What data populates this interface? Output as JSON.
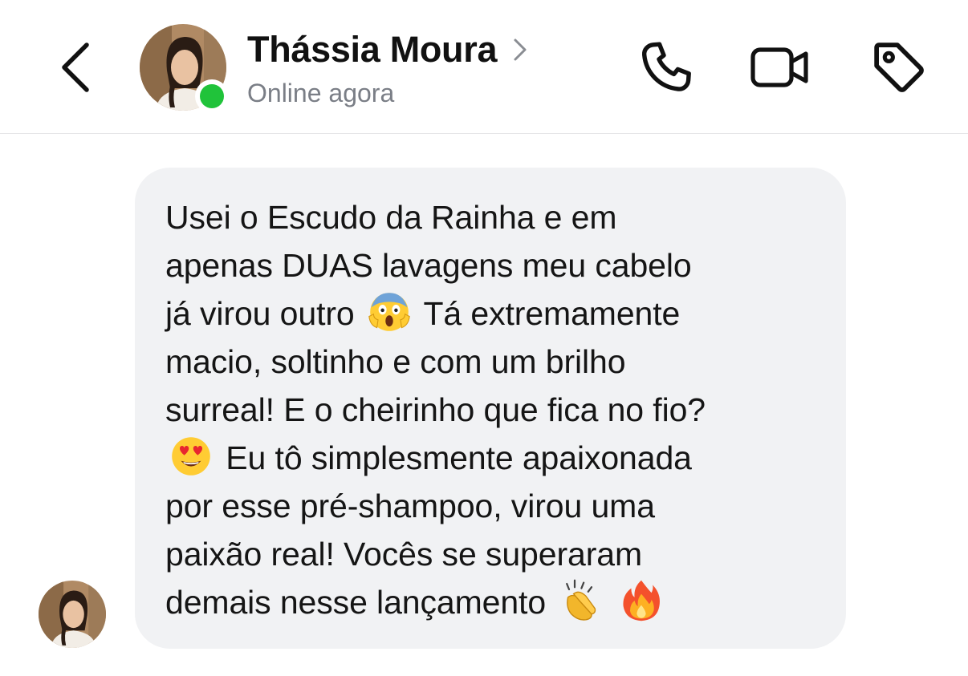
{
  "header": {
    "contact_name": "Thássia Moura",
    "status": "Online agora",
    "icons": {
      "back": "chevron-left-icon",
      "name_chevron": "chevron-right-icon",
      "call": "phone-icon",
      "video": "video-camera-icon",
      "tag": "tag-icon"
    },
    "online_color": "#20c33a"
  },
  "messages": [
    {
      "sender": "Thássia Moura",
      "segments": [
        "Usei o Escudo da Rainha e em\napenas DUAS lavagens meu cabelo\njá virou outro ",
        " Tá extremamente\nmacio, soltinho e com um brilho\nsurreal! E o cheirinho que fica no fio?\n",
        " Eu tô simplesmente apaixonada\npor esse pré-shampoo, virou uma\npaixão real! Vocês se superaram\ndemais nesse lançamento ",
        " "
      ],
      "emojis": [
        "face-screaming-in-fear-emoji",
        "heart-eyes-emoji",
        "clapping-hands-emoji",
        "fire-emoji"
      ],
      "bubble_color": "#f1f2f4"
    }
  ]
}
